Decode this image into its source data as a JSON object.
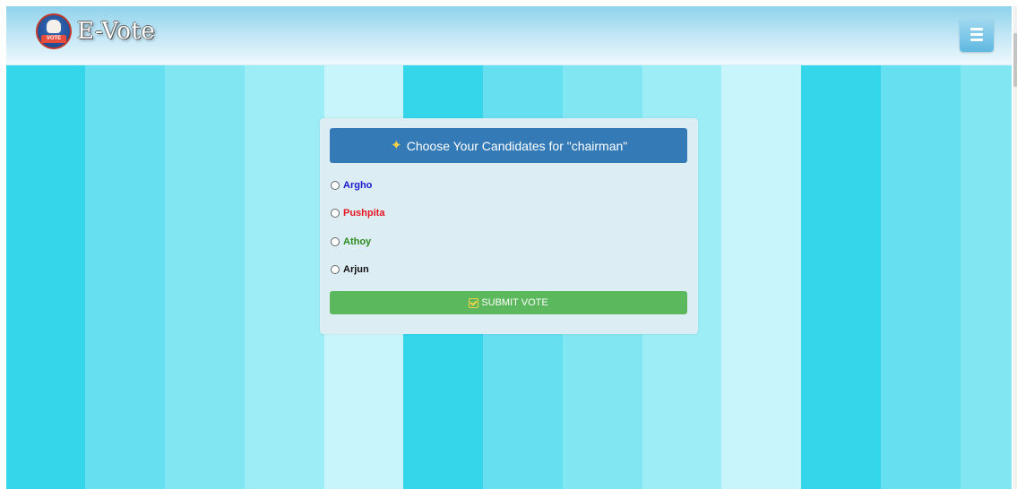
{
  "brand": {
    "name": "E-Vote",
    "logo_icon": "vote-hand-logo",
    "logo_ribbon": "VOTE"
  },
  "nav": {
    "menu_icon": "hamburger-menu-icon"
  },
  "ballot": {
    "title": "Choose Your Candidates for \"chairman\"",
    "title_icon": "star-icon",
    "candidates": [
      {
        "name": "Argho",
        "color": "#1a1acc"
      },
      {
        "name": "Pushpita",
        "color": "#e8141e"
      },
      {
        "name": "Athoy",
        "color": "#2e8b1e"
      },
      {
        "name": "Arjun",
        "color": "#111111"
      }
    ],
    "submit_label": "SUBMIT VOTE",
    "submit_icon": "check-square-icon"
  },
  "colors": {
    "header_blue": "#337ab7",
    "submit_green": "#5cb85c",
    "stripe_cyan": "#35d5ea"
  }
}
